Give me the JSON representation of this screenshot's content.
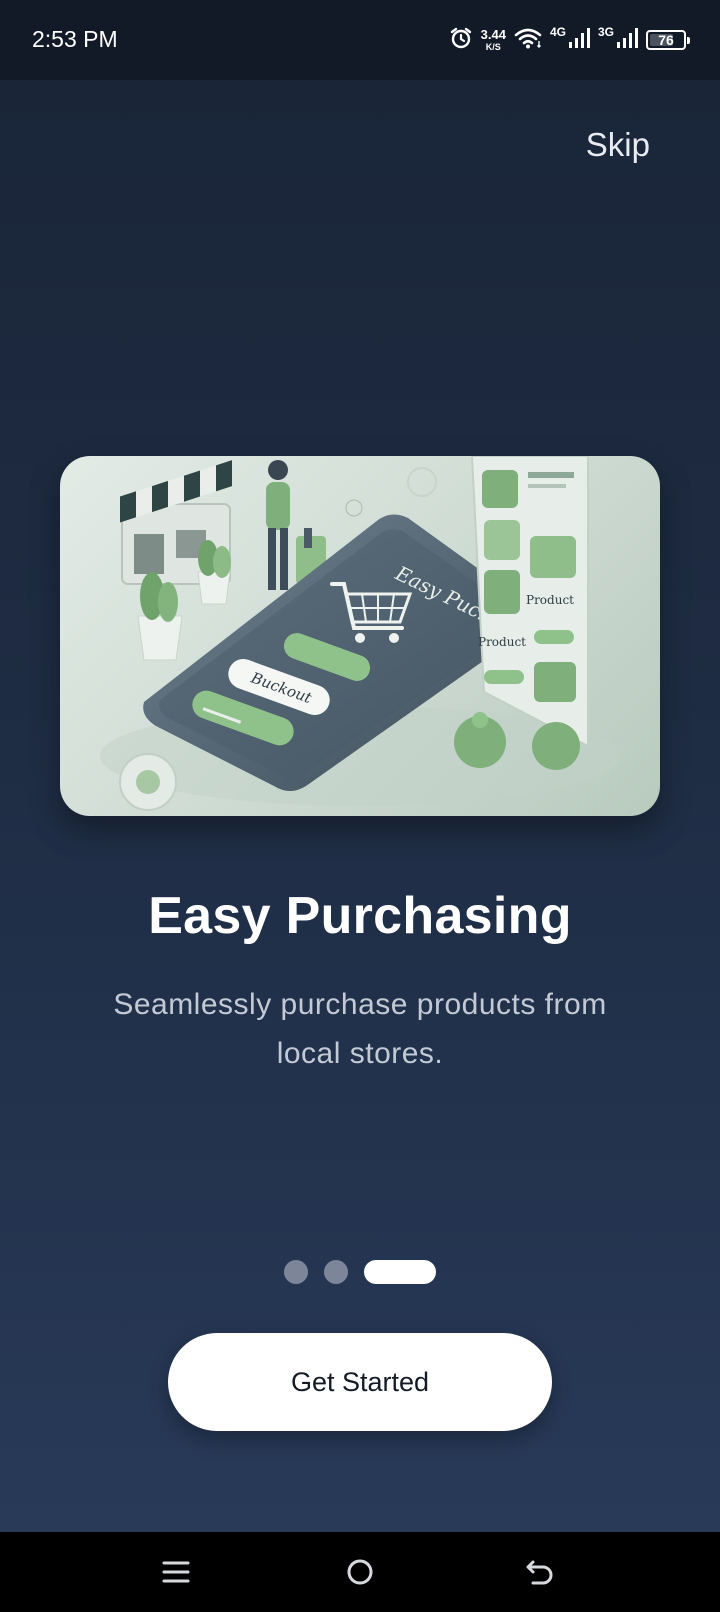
{
  "status_bar": {
    "time": "2:53 PM",
    "speed_value": "3.44",
    "speed_unit": "K/S",
    "net1": "4G",
    "net2": "3G",
    "battery": "76",
    "battery_level": 0.76,
    "icons": [
      "alarm-icon",
      "wifi-icon",
      "signal-icon",
      "signal-icon",
      "battery-icon"
    ]
  },
  "onboarding": {
    "skip_label": "Skip",
    "image_text": {
      "phone_title": "Easy Puchase",
      "pill_main": "Buckout",
      "panel_label_1": "Product",
      "panel_label_2": "Product"
    },
    "title": "Easy Purchasing",
    "subtitle": "Seamlessly purchase products from local stores.",
    "page_count": 3,
    "active_page": 3,
    "cta_label": "Get Started"
  },
  "nav_bar": {
    "buttons": [
      "menu-icon",
      "home-icon",
      "back-icon"
    ]
  },
  "colors": {
    "background_top": "#1a2538",
    "background_bottom": "#283a58",
    "accent_green": "#7fb07c",
    "dot_inactive": "#7c8698",
    "dot_active": "#ffffff",
    "button_bg": "#ffffff"
  }
}
